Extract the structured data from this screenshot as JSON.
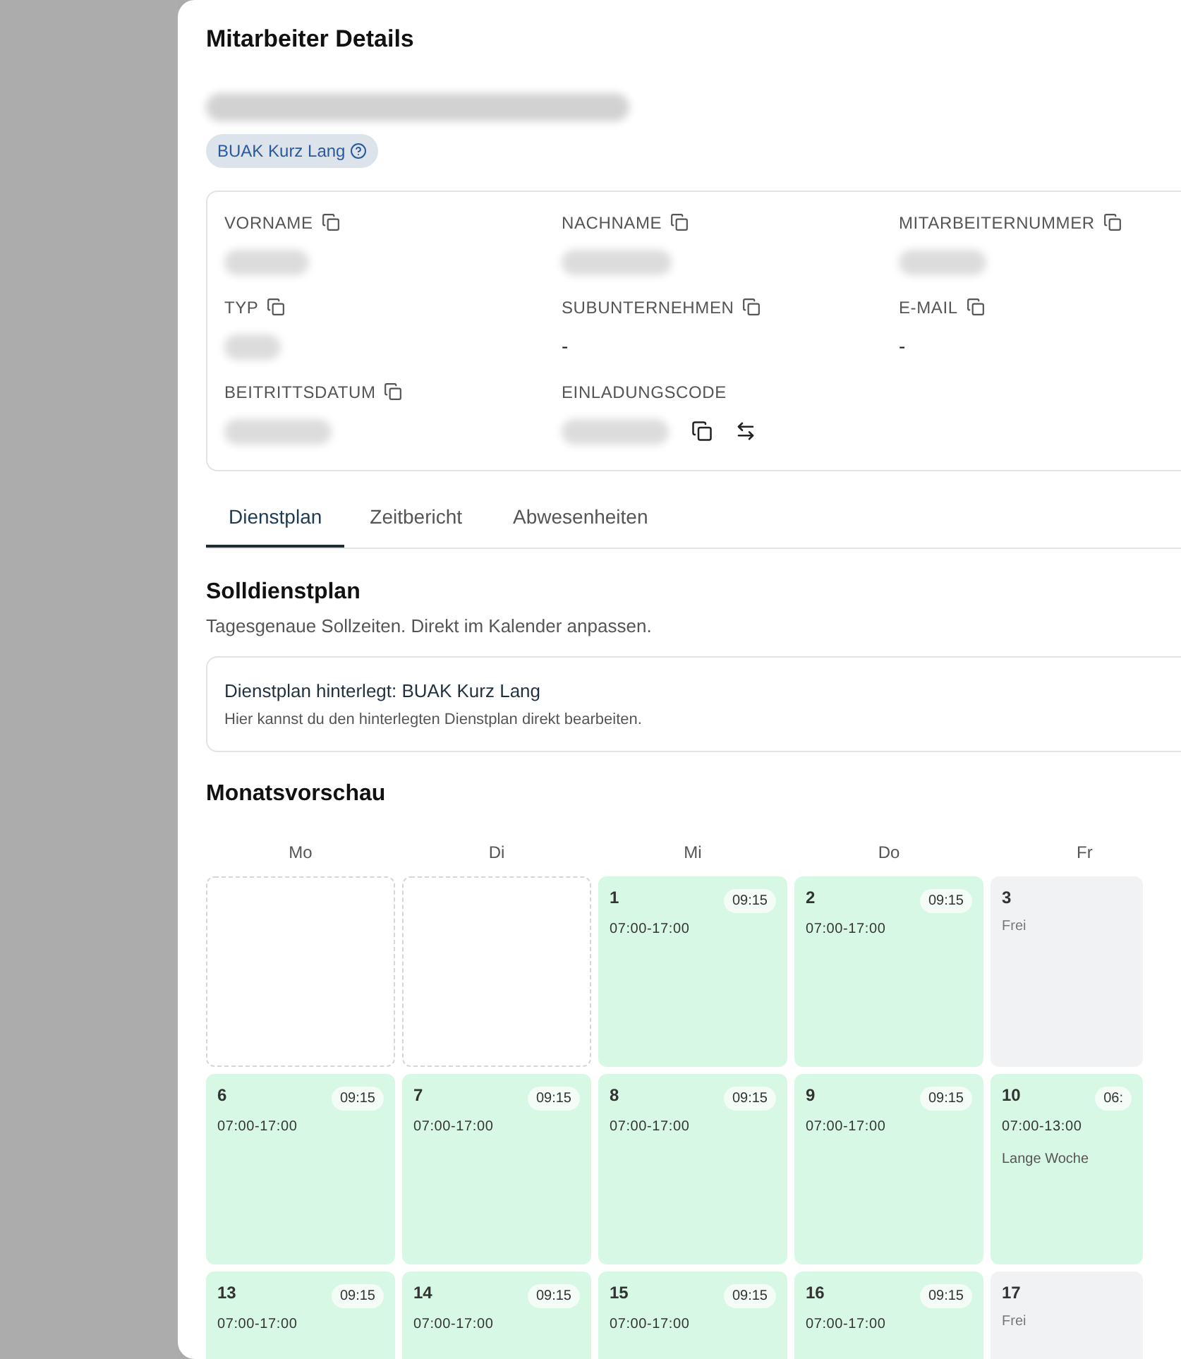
{
  "dialog": {
    "title": "Mitarbeiter Details",
    "badge": {
      "label": "BUAK Kurz Lang"
    },
    "fields": [
      {
        "label": "VORNAME",
        "copyable": true,
        "kind": "redacted"
      },
      {
        "label": "NACHNAME",
        "copyable": true,
        "kind": "redacted"
      },
      {
        "label": "MITARBEITERNUMMER",
        "copyable": true,
        "kind": "redacted"
      },
      {
        "label": "TYP",
        "copyable": true,
        "kind": "redacted"
      },
      {
        "label": "SUBUNTERNEHMEN",
        "copyable": true,
        "kind": "text",
        "value": "-"
      },
      {
        "label": "E-MAIL",
        "copyable": true,
        "kind": "text",
        "value": "-"
      },
      {
        "label": "BEITRITTSDATUM",
        "copyable": true,
        "kind": "redacted"
      },
      {
        "label": "EINLADUNGSCODE",
        "copyable": false,
        "kind": "code"
      }
    ],
    "tabs": [
      {
        "label": "Dienstplan",
        "selected": true
      },
      {
        "label": "Zeitbericht",
        "selected": false
      },
      {
        "label": "Abwesenheiten",
        "selected": false
      }
    ],
    "section": {
      "title": "Solldienstplan",
      "subtitle": "Tagesgenaue Sollzeiten. Direkt im Kalender anpassen.",
      "plan_card": {
        "title": "Dienstplan hinterlegt: BUAK Kurz Lang",
        "text": "Hier kannst du den hinterlegten Dienstplan direkt bearbeiten."
      }
    },
    "calendar": {
      "title": "Monatsvorschau",
      "weekdays": [
        "Mo",
        "Di",
        "Mi",
        "Do",
        "Fr"
      ],
      "weeks": [
        [
          {
            "kind": "empty"
          },
          {
            "kind": "empty"
          },
          {
            "kind": "shift",
            "day": "1",
            "hours": "09:15",
            "time": "07:00-17:00"
          },
          {
            "kind": "shift",
            "day": "2",
            "hours": "09:15",
            "time": "07:00-17:00"
          },
          {
            "kind": "off",
            "day": "3",
            "label": "Frei"
          }
        ],
        [
          {
            "kind": "shift",
            "day": "6",
            "hours": "09:15",
            "time": "07:00-17:00"
          },
          {
            "kind": "shift",
            "day": "7",
            "hours": "09:15",
            "time": "07:00-17:00"
          },
          {
            "kind": "shift",
            "day": "8",
            "hours": "09:15",
            "time": "07:00-17:00"
          },
          {
            "kind": "shift",
            "day": "9",
            "hours": "09:15",
            "time": "07:00-17:00"
          },
          {
            "kind": "shift",
            "day": "10",
            "hours": "06:",
            "time": "07:00-13:00",
            "note": "Lange Woche"
          }
        ],
        [
          {
            "kind": "shift",
            "day": "13",
            "hours": "09:15",
            "time": "07:00-17:00"
          },
          {
            "kind": "shift",
            "day": "14",
            "hours": "09:15",
            "time": "07:00-17:00"
          },
          {
            "kind": "shift",
            "day": "15",
            "hours": "09:15",
            "time": "07:00-17:00"
          },
          {
            "kind": "shift",
            "day": "16",
            "hours": "09:15",
            "time": "07:00-17:00"
          },
          {
            "kind": "off",
            "day": "17",
            "label": "Frei"
          }
        ]
      ]
    }
  }
}
